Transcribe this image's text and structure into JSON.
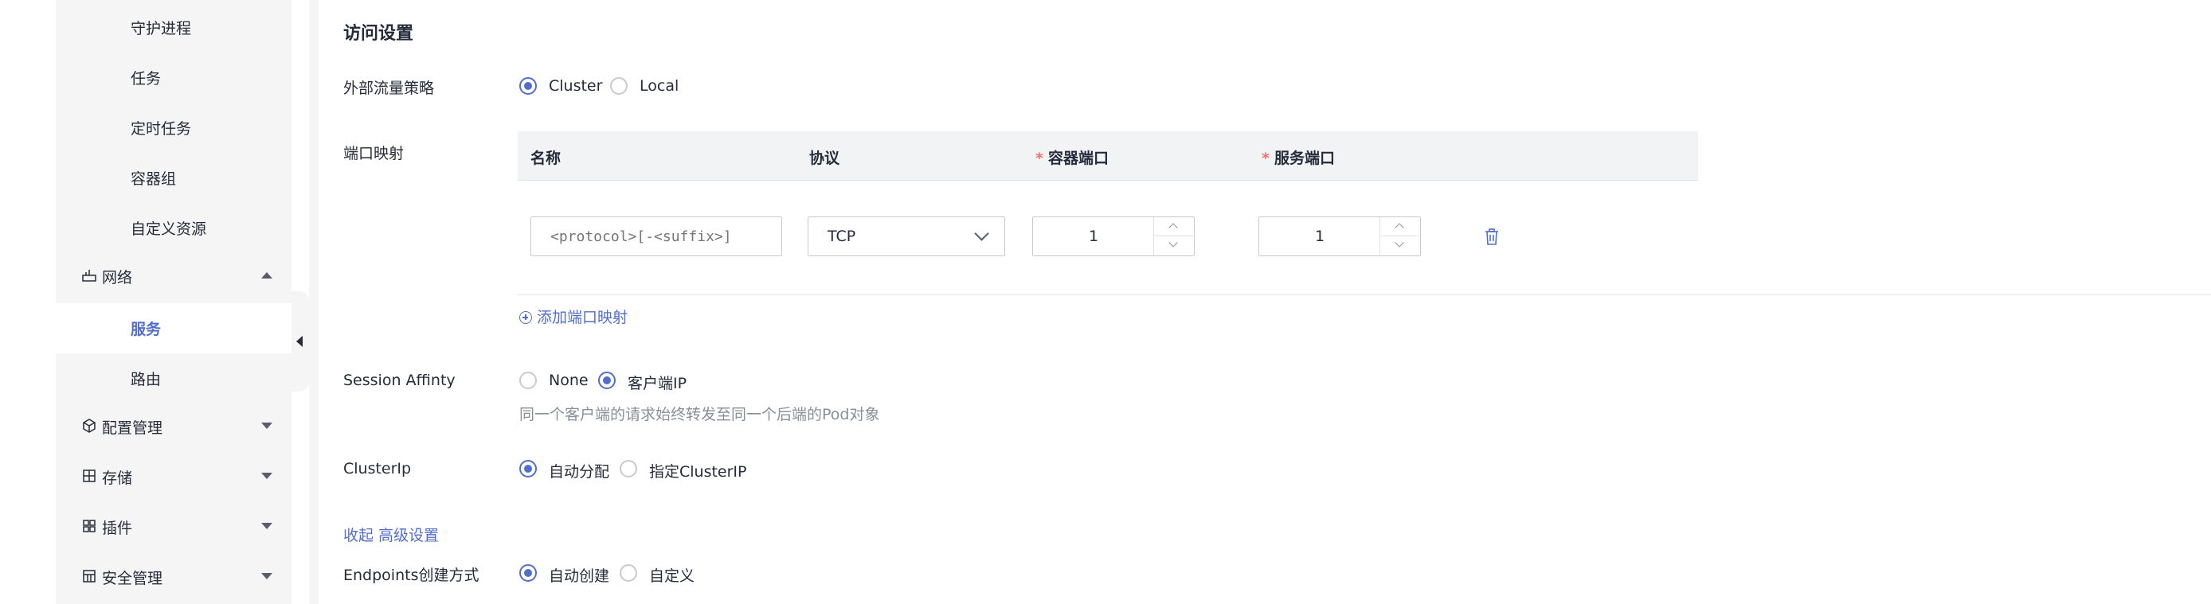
{
  "sidebar": {
    "sub_items": [
      {
        "label": "守护进程"
      },
      {
        "label": "任务"
      },
      {
        "label": "定时任务"
      },
      {
        "label": "容器组"
      },
      {
        "label": "自定义资源"
      }
    ],
    "network_group": {
      "label": "网络",
      "icon": "network-icon",
      "expanded": true
    },
    "network_items": [
      {
        "label": "服务",
        "active": true
      },
      {
        "label": "路由"
      }
    ],
    "groups": [
      {
        "label": "配置管理",
        "icon": "cube-icon"
      },
      {
        "label": "存储",
        "icon": "storage-icon"
      },
      {
        "label": "插件",
        "icon": "plugin-icon"
      },
      {
        "label": "安全管理",
        "icon": "security-icon"
      }
    ]
  },
  "form": {
    "section_title": "访问设置",
    "traffic_policy": {
      "label": "外部流量策略",
      "options": [
        "Cluster",
        "Local"
      ],
      "selected": "Cluster"
    },
    "port_mapping": {
      "label": "端口映射",
      "columns": {
        "name": "名称",
        "protocol": "协议",
        "container_port": "容器端口",
        "service_port": "服务端口",
        "required_mark": "*"
      },
      "row": {
        "name_placeholder": "<protocol>[-<suffix>]",
        "protocol": "TCP",
        "container_port": "1",
        "service_port": "1"
      },
      "add_label": "添加端口映射"
    },
    "session_affinity": {
      "label": "Session Affinty",
      "options": [
        "None",
        "客户端IP"
      ],
      "selected": "客户端IP",
      "hint": "同一个客户端的请求始终转发至同一个后端的Pod对象"
    },
    "cluster_ip": {
      "label": "ClusterIp",
      "options": [
        "自动分配",
        "指定ClusterIP"
      ],
      "selected": "自动分配"
    },
    "advanced_toggle": "收起 高级设置",
    "endpoints": {
      "label": "Endpoints创建方式",
      "options": [
        "自动创建",
        "自定义"
      ],
      "selected": "自动创建"
    }
  },
  "colors": {
    "accent": "#526ecc",
    "sidebar_bg": "#f5f5f6",
    "required": "#f66f6a"
  }
}
